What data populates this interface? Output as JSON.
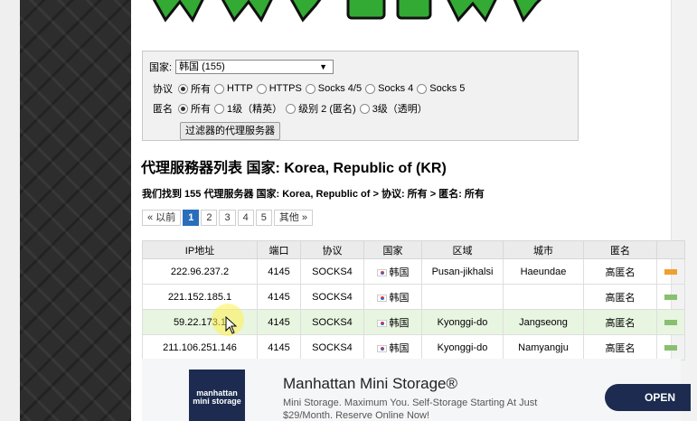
{
  "filters": {
    "country_label": "国家:",
    "country_value": "韩国 (155)",
    "protocol_label": "协议",
    "protocol_options": [
      "所有",
      "HTTP",
      "HTTPS",
      "Socks 4/5",
      "Socks 4",
      "Socks 5"
    ],
    "protocol_selected": "所有",
    "anonymity_label": "匿名",
    "anonymity_options": [
      "所有",
      "1级（精英）",
      "级别 2 (匿名)",
      "3级（透明）"
    ],
    "anonymity_selected": "所有",
    "submit_label": "过滤器的代理服务器"
  },
  "heading": "代理服務器列表 国家: Korea, Republic of (KR)",
  "breadcrumb": "我们找到 155 代理服务器 国家: Korea, Republic of > 协议: 所有 > 匿名: 所有",
  "pagination": {
    "prev": "« 以前",
    "pages": [
      "1",
      "2",
      "3",
      "4",
      "5"
    ],
    "current": "1",
    "next": "其他 »"
  },
  "table": {
    "headers": [
      "IP地址",
      "端口",
      "协议",
      "国家",
      "区域",
      "城市",
      "匿名"
    ],
    "rows": [
      {
        "ip": "222.96.237.2",
        "port": "4145",
        "protocol": "SOCKS4",
        "country": "韩国",
        "region": "Pusan-jikhalsi",
        "city": "Haeundae",
        "anonymity": "高匿名",
        "speed_color": "#f0a030"
      },
      {
        "ip": "221.152.185.1",
        "port": "4145",
        "protocol": "SOCKS4",
        "country": "韩国",
        "region": "",
        "city": "",
        "anonymity": "高匿名",
        "speed_color": "#88c070"
      },
      {
        "ip": "59.22.173.1",
        "port": "4145",
        "protocol": "SOCKS4",
        "country": "韩国",
        "region": "Kyonggi-do",
        "city": "Jangseong",
        "anonymity": "高匿名",
        "speed_color": "#88c070"
      },
      {
        "ip": "211.106.251.146",
        "port": "4145",
        "protocol": "SOCKS4",
        "country": "韩国",
        "region": "Kyonggi-do",
        "city": "Namyangju",
        "anonymity": "高匿名",
        "speed_color": "#88c070"
      }
    ]
  },
  "ad": {
    "logo_line1": "manhattan",
    "logo_line2": "mini storage",
    "title": "Manhattan Mini Storage®",
    "description": "Mini Storage. Maximum You. Self-Storage Starting At Just $29/Month. Reserve Online Now!",
    "cta": "OPEN"
  }
}
